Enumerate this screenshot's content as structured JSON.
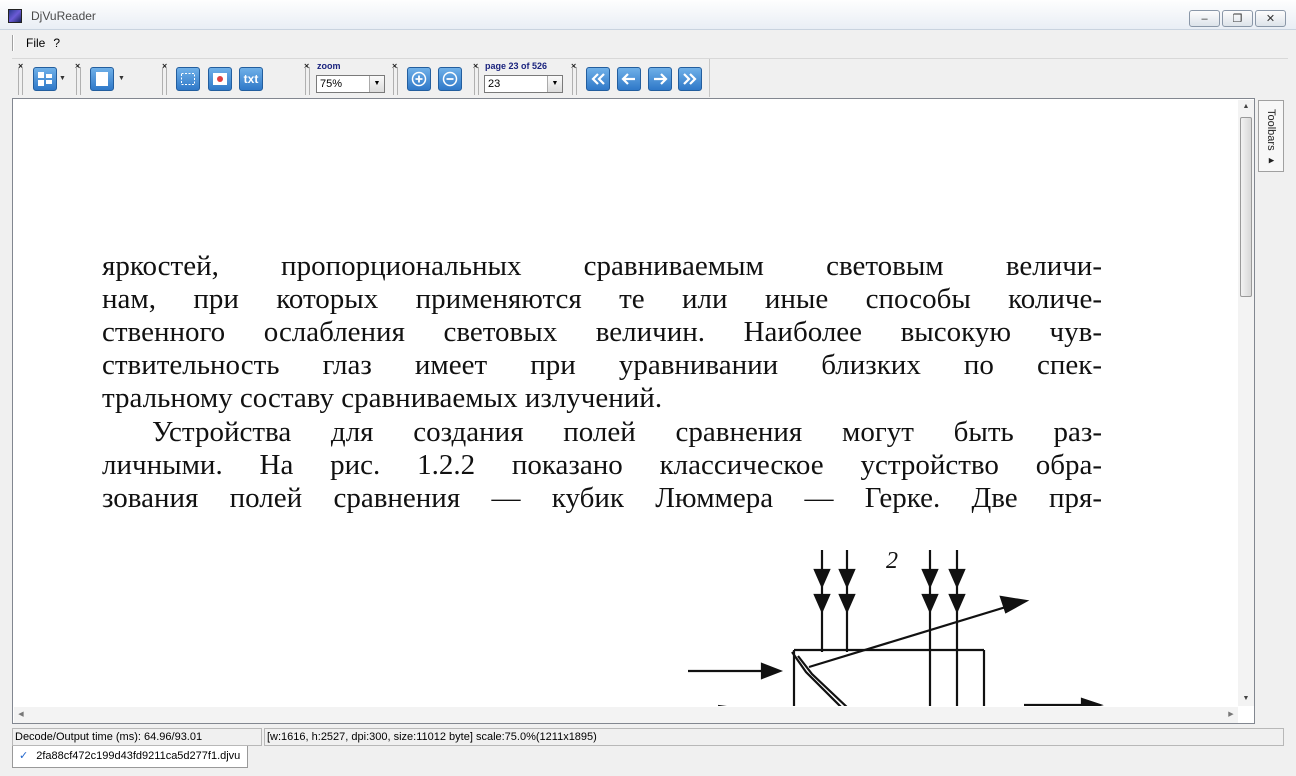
{
  "window": {
    "title": "DjVuReader",
    "controls": {
      "minimize": "–",
      "maximize": "❐",
      "close": "✕"
    }
  },
  "menu": {
    "items": [
      "File",
      "?"
    ]
  },
  "toolbar": {
    "close_glyph": "×",
    "txt_label": "txt",
    "zoom": {
      "label": "zoom",
      "value": "75%"
    },
    "page": {
      "label": "page 23 of 526",
      "value": "23"
    },
    "nav_icons": [
      "first-page-icon",
      "previous-page-icon",
      "next-page-icon",
      "last-page-icon"
    ],
    "zoom_icons": [
      "zoom-in-icon",
      "zoom-out-icon"
    ],
    "accent": "#2f78c8"
  },
  "document": {
    "paragraph1": [
      "яркостей, пропорциональных сравниваемым световым величи-",
      "нам, при которых применяются те или иные способы количе-",
      "ственного ослабления световых величин. Наиболее высокую чув-",
      "ствительность глаз имеет при уравнивании близких по спек-",
      "тральному составу сравниваемых излучений."
    ],
    "paragraph2": [
      "Устройства для создания полей сравнения могут быть раз-",
      "личными. На рис. 1.2.2 показано классическое устройство обра-",
      "зования полей сравнения — кубик Люммера — Герке. Две пря-"
    ],
    "figure_label": "2"
  },
  "sidebar": {
    "toolbars_tab": "Toolbars ▸"
  },
  "status": {
    "decode_time": "Decode/Output time (ms): 64.96/93.01",
    "page_info": "[w:1616, h:2527, dpi:300, size:11012 byte] scale:75.0%(1211x1895)"
  },
  "file_tab": {
    "name": "2fa88cf472c199d43fd9211ca5d277f1.djvu"
  }
}
